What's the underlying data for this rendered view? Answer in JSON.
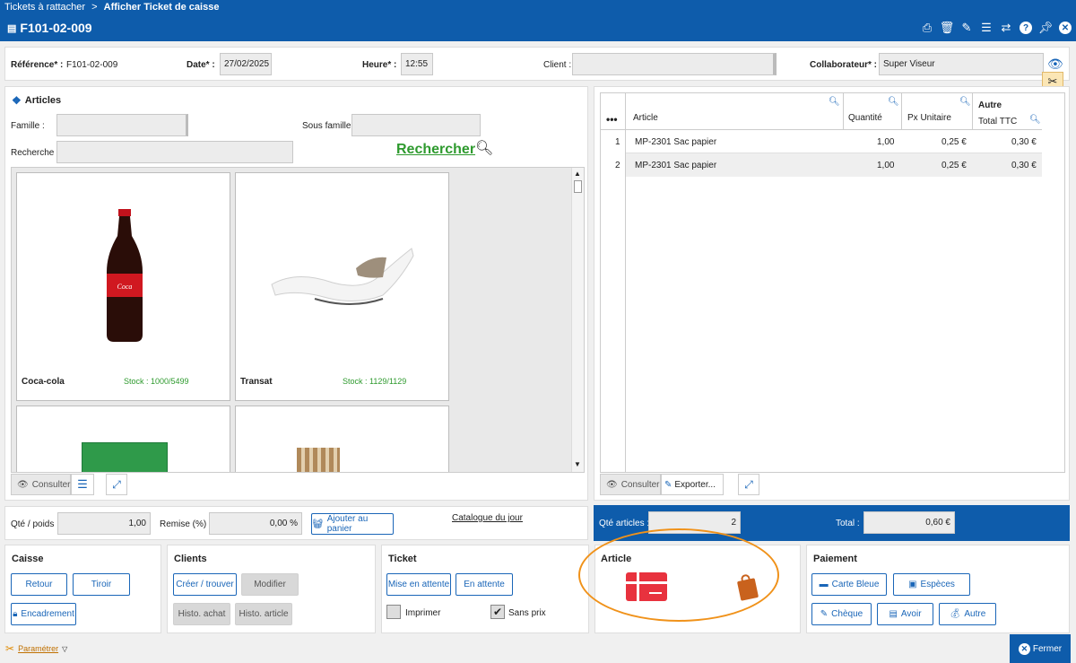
{
  "breadcrumb": {
    "parent": "Tickets à rattacher",
    "sep": ">",
    "current": "Afficher Ticket de caisse"
  },
  "title": "F101-02-009",
  "toolbar_icons": [
    "print-icon",
    "trash-icon",
    "edit-icon",
    "menu-icon",
    "refresh-icon",
    "help-icon",
    "pin-icon",
    "close-icon"
  ],
  "form": {
    "reference_label": "Référence* :",
    "reference_value": "F101-02-009",
    "date_label": "Date* :",
    "date_value": "27/02/2025",
    "heure_label": "Heure* :",
    "heure_value": "12:55",
    "client_label": "Client :",
    "client_value": "",
    "collab_label": "Collaborateur* :",
    "collab_value": "Super Viseur"
  },
  "articles": {
    "title": "Articles",
    "famille_label": "Famille :",
    "sousfamille_label": "Sous famille :",
    "recherche_label": "Recherche :",
    "search_btn": "Rechercher",
    "products": [
      {
        "name": "Coca-cola",
        "stock": "Stock : 1000/5499"
      },
      {
        "name": "Transat",
        "stock": "Stock : 1129/1129"
      }
    ],
    "consulter": "Consulter"
  },
  "ticket_table": {
    "headers": {
      "more": "•••",
      "article": "Article",
      "qty": "Quantité",
      "pu": "Px Unitaire",
      "autre": "Autre",
      "total": "Total TTC"
    },
    "rows": [
      {
        "n": "1",
        "article": "MP-2301 Sac papier",
        "qty": "1,00",
        "pu": "0,25 €",
        "total": "0,30 €"
      },
      {
        "n": "2",
        "article": "MP-2301 Sac papier",
        "qty": "1,00",
        "pu": "0,25 €",
        "total": "0,30 €"
      }
    ],
    "consulter": "Consulter",
    "exporter": "Exporter..."
  },
  "qty_bar": {
    "qty_label": "Qté / poids :",
    "qty_value": "1,00",
    "remise_label": "Remise (%) :",
    "remise_value": "0,00 %",
    "add_btn": "Ajouter au panier",
    "catalogue": "Catalogue du jour"
  },
  "totals": {
    "qte_label": "Qté articles :",
    "qte_value": "2",
    "total_label": "Total :",
    "total_value": "0,60 €"
  },
  "caisse": {
    "title": "Caisse",
    "retour": "Retour",
    "tiroir": "Tiroir",
    "encadrement": "Encadrement"
  },
  "clients": {
    "title": "Clients",
    "creer": "Créer / trouver",
    "modifier": "Modifier",
    "histo_achat": "Histo. achat",
    "histo_article": "Histo. article"
  },
  "ticket": {
    "title": "Ticket",
    "mise": "Mise en attente",
    "en_attente": "En attente",
    "imprimer": "Imprimer",
    "sans_prix": "Sans prix"
  },
  "article_sec": {
    "title": "Article"
  },
  "paiement": {
    "title": "Paiement",
    "cb": "Carte Bleue",
    "especes": "Espèces",
    "cheque": "Chèque",
    "avoir": "Avoir",
    "autre": "Autre"
  },
  "footer": {
    "parametrer": "Paramétrer",
    "fermer": "Fermer"
  },
  "colors": {
    "brand": "#0e5cab",
    "accent_green": "#2e9a2e",
    "highlight": "#f0921a"
  }
}
